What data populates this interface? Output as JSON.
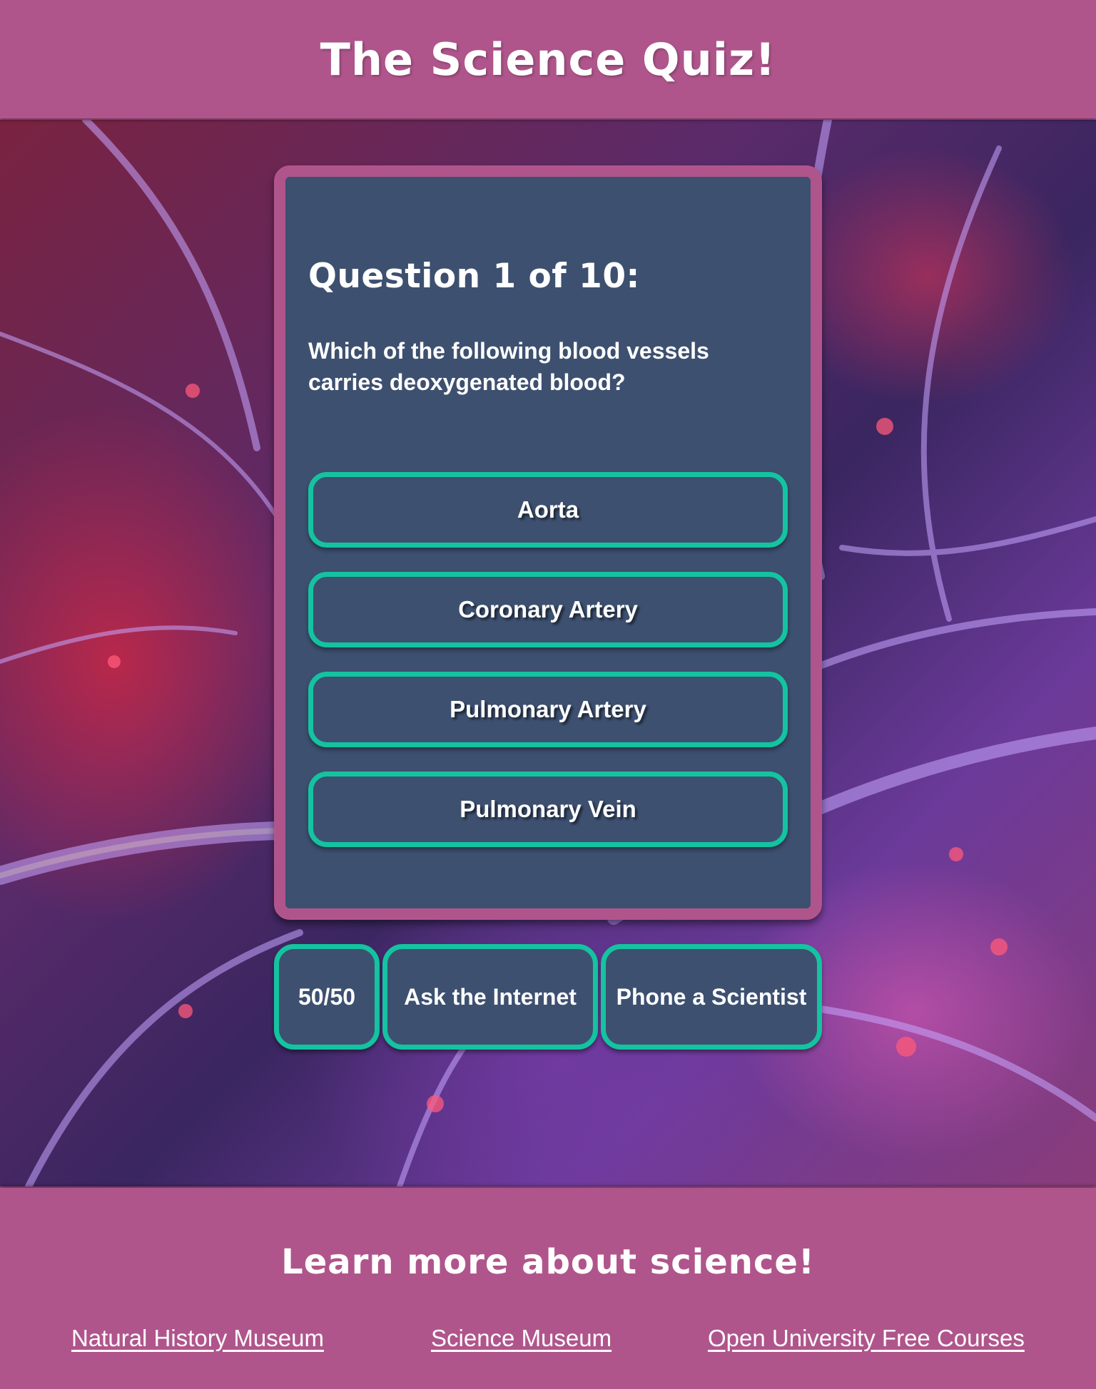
{
  "header": {
    "title": "The Science Quiz!"
  },
  "quiz": {
    "question_title": "Question 1 of 10:",
    "question_text": "Which of the following blood vessels carries deoxygenated blood?",
    "answers": [
      {
        "label": "Aorta"
      },
      {
        "label": "Coronary Artery"
      },
      {
        "label": "Pulmonary Artery"
      },
      {
        "label": "Pulmonary Vein"
      }
    ]
  },
  "lifelines": {
    "fifty_fifty": "50/50",
    "ask_internet": "Ask the Internet",
    "phone_scientist": "Phone a Scientist"
  },
  "footer": {
    "heading": "Learn more about science!",
    "links": [
      {
        "label": "Natural History Museum"
      },
      {
        "label": "Science Museum"
      },
      {
        "label": "Open University Free Courses"
      }
    ]
  },
  "colors": {
    "brand": "#b0558c",
    "card": "#3d5070",
    "accent": "#14c3a0",
    "text": "#ffffff"
  }
}
